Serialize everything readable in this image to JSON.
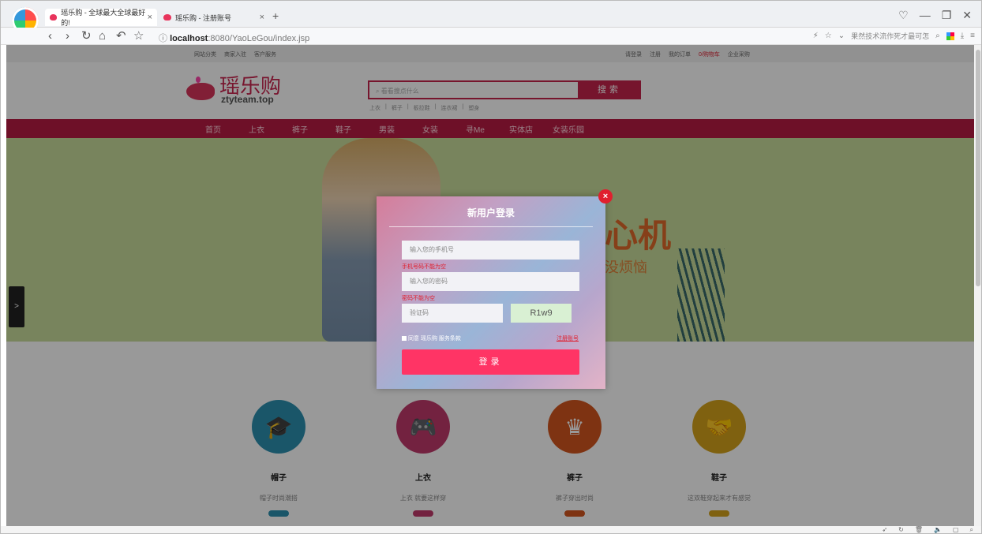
{
  "browser": {
    "tabs": [
      {
        "title": "瑶乐购 - 全球最大全球最好的!"
      },
      {
        "title": "瑶乐购 - 注册账号"
      }
    ],
    "url_host": "localhost",
    "url_rest": ":8080/YaoLeGou/index.jsp",
    "search_hint": "果然技术流作死才最可怎",
    "controls": [
      "♡",
      "—",
      "❐",
      "✕"
    ]
  },
  "topbar": {
    "left_links": [
      "网站分类",
      "商家入驻",
      "客户服务"
    ],
    "right_links": [
      "请登录",
      "注册",
      "我的订单",
      "购物车",
      "企业采购"
    ],
    "cart_count": "0"
  },
  "logo": {
    "brand": "瑶乐购",
    "domain": "ztyteam.top"
  },
  "search": {
    "placeholder": "看看搜点什么",
    "button": "搜索",
    "hot": [
      "上衣",
      "裤子",
      "板拉鞋",
      "连衣裙",
      "塑身"
    ]
  },
  "nav": [
    "首页",
    "上衣",
    "裤子",
    "鞋子",
    "男装",
    "女装",
    "寻Me",
    "实体店",
    "女装乐园"
  ],
  "banner": {
    "text_big": "心机",
    "text_small": "没烦恼"
  },
  "features": [
    {
      "title": "帽子",
      "desc": "帽子时尚潮搭",
      "color": "#2c8fb0",
      "icon": "graduation-cap-icon"
    },
    {
      "title": "上衣",
      "desc": "上衣 就要这样穿",
      "color": "#c03a6b",
      "icon": "gamepad-icon"
    },
    {
      "title": "裤子",
      "desc": "裤子穿出时尚",
      "color": "#d3561f",
      "icon": "crown-icon"
    },
    {
      "title": "鞋子",
      "desc": "这双鞋穿起来才有感觉",
      "color": "#d4a21b",
      "icon": "handshake-icon"
    }
  ],
  "modal": {
    "title": "新用户登录",
    "phone_placeholder": "输入您的手机号",
    "phone_error": "手机号码不能为空",
    "password_placeholder": "输入您的密码",
    "password_error": "密码不能为空",
    "captcha_placeholder": "验证码",
    "captcha_code": "R1w9",
    "agree_text": "同意 瑶乐购 服务条款",
    "register_link": "注册账号",
    "login_button": "登录"
  }
}
